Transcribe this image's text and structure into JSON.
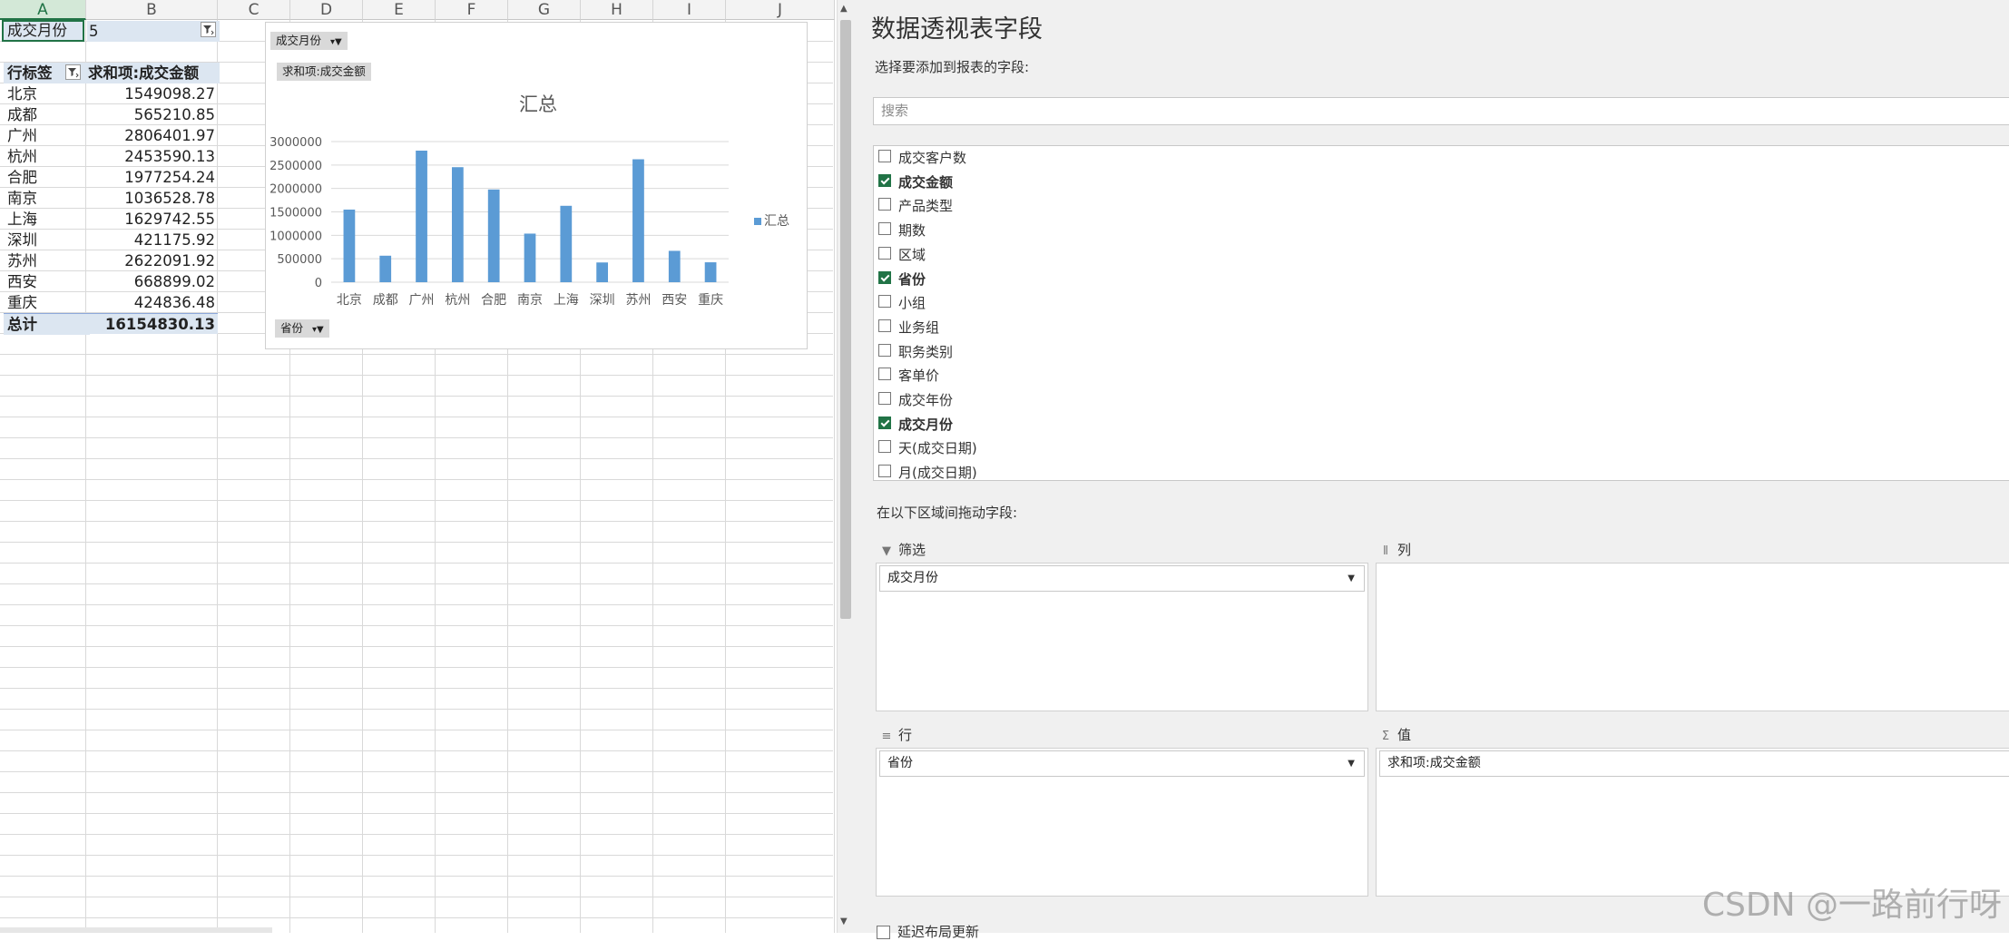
{
  "sheet": {
    "columns": [
      "A",
      "B",
      "C",
      "D",
      "E",
      "F",
      "G",
      "H",
      "I",
      "J"
    ],
    "filter_label": "成交月份",
    "filter_value": "5",
    "row_header": "行标签",
    "value_header": "求和项:成交金额",
    "rows": [
      {
        "label": "北京",
        "value": "1549098.27"
      },
      {
        "label": "成都",
        "value": "565210.85"
      },
      {
        "label": "广州",
        "value": "2806401.97"
      },
      {
        "label": "杭州",
        "value": "2453590.13"
      },
      {
        "label": "合肥",
        "value": "1977254.24"
      },
      {
        "label": "南京",
        "value": "1036528.78"
      },
      {
        "label": "上海",
        "value": "1629742.55"
      },
      {
        "label": "深圳",
        "value": "421175.92"
      },
      {
        "label": "苏州",
        "value": "2622091.92"
      },
      {
        "label": "西安",
        "value": "668899.02"
      },
      {
        "label": "重庆",
        "value": "424836.48"
      }
    ],
    "total_label": "总计",
    "total_value": "16154830.13"
  },
  "chart_data": {
    "type": "bar",
    "title": "汇总",
    "categories": [
      "北京",
      "成都",
      "广州",
      "杭州",
      "合肥",
      "南京",
      "上海",
      "深圳",
      "苏州",
      "西安",
      "重庆"
    ],
    "series": [
      {
        "name": "汇总",
        "values": [
          1549098.27,
          565210.85,
          2806401.97,
          2453590.13,
          1977254.24,
          1036528.78,
          1629742.55,
          421175.92,
          2622091.92,
          668899.02,
          424836.48
        ]
      }
    ],
    "ylim": [
      0,
      3000000
    ],
    "yticks": [
      "3000000",
      "2500000",
      "2000000",
      "1500000",
      "1000000",
      "500000",
      "0"
    ],
    "legend": "right",
    "grid": true,
    "bar_color": "#5b9bd5",
    "filter_button": "成交月份",
    "value_button": "求和项:成交金额",
    "axis_button": "省份"
  },
  "pane": {
    "title": "数据透视表字段",
    "subtitle": "选择要添加到报表的字段:",
    "search_placeholder": "搜索",
    "fields": [
      {
        "label": "成交客户数",
        "checked": false
      },
      {
        "label": "成交金额",
        "checked": true
      },
      {
        "label": "产品类型",
        "checked": false
      },
      {
        "label": "期数",
        "checked": false
      },
      {
        "label": "区域",
        "checked": false
      },
      {
        "label": "省份",
        "checked": true
      },
      {
        "label": "小组",
        "checked": false
      },
      {
        "label": "业务组",
        "checked": false
      },
      {
        "label": "职务类别",
        "checked": false
      },
      {
        "label": "客单价",
        "checked": false
      },
      {
        "label": "成交年份",
        "checked": false
      },
      {
        "label": "成交月份",
        "checked": true
      },
      {
        "label": "天(成交日期)",
        "checked": false
      },
      {
        "label": "月(成交日期)",
        "checked": false
      }
    ],
    "drag_label": "在以下区域间拖动字段:",
    "areas": {
      "filter": {
        "label": "筛选",
        "item": "成交月份"
      },
      "columns": {
        "label": "列"
      },
      "rows": {
        "label": "行",
        "item": "省份"
      },
      "values": {
        "label": "值",
        "item": "求和项:成交金额"
      }
    },
    "defer_label": "延迟布局更新"
  },
  "watermark": "CSDN @一路前行呀",
  "colors": {
    "accent": "#217346",
    "header_fill": "#dce6f1",
    "bar": "#5b9bd5"
  }
}
